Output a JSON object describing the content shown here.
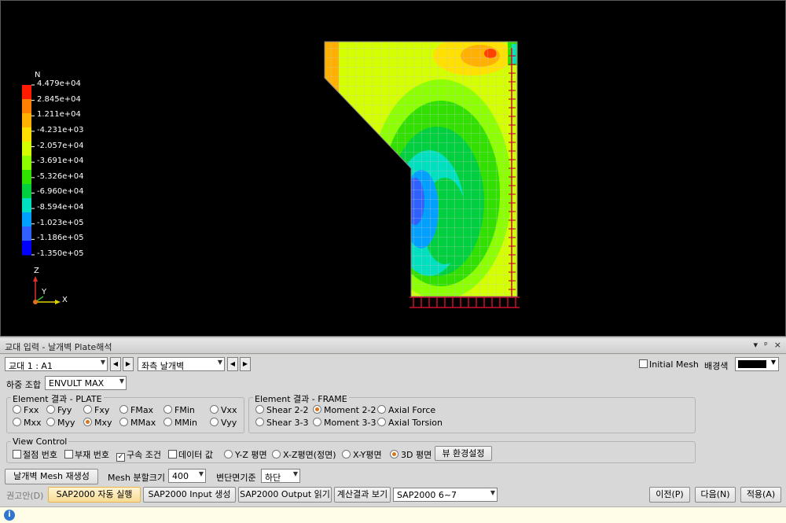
{
  "viewport": {
    "legend_unit": "N",
    "legend_labels": [
      "4.479e+04",
      "2.845e+04",
      "1.211e+04",
      "-4.231e+03",
      "-2.057e+04",
      "-3.691e+04",
      "-5.326e+04",
      "-6.960e+04",
      "-8.594e+04",
      "-1.023e+05",
      "-1.186e+05",
      "-1.350e+05"
    ],
    "legend_colors": [
      "#ff1a00",
      "#ff8000",
      "#ffb000",
      "#ffe000",
      "#d4ff00",
      "#8cff00",
      "#32e000",
      "#00d040",
      "#00e0c0",
      "#00a0ff",
      "#3060ff",
      "#0000ff"
    ],
    "axis": {
      "z": "Z",
      "x": "X",
      "y": "Y"
    }
  },
  "panel": {
    "title": "교대 입력 - 날개벽 Plate해석",
    "title_controls": [
      "▾",
      "ᵖ",
      "×"
    ],
    "abutment_select": "교대 1 : A1",
    "wall_select": "좌측 날개벽",
    "initial_mesh_label": "Initial Mesh",
    "bg_color_label": "배경색",
    "load_combo_label": "하중 조합",
    "load_combo_value": "ENVULT MAX",
    "plate_group": {
      "title": "Element 결과 - PLATE",
      "options": [
        {
          "label": "Fxx",
          "selected": false
        },
        {
          "label": "Fyy",
          "selected": false
        },
        {
          "label": "Fxy",
          "selected": false
        },
        {
          "label": "FMax",
          "selected": false
        },
        {
          "label": "FMin",
          "selected": false
        },
        {
          "label": "Vxx",
          "selected": false
        },
        {
          "label": "Mxx",
          "selected": false
        },
        {
          "label": "Myy",
          "selected": false
        },
        {
          "label": "Mxy",
          "selected": true
        },
        {
          "label": "MMax",
          "selected": false
        },
        {
          "label": "MMin",
          "selected": false
        },
        {
          "label": "Vyy",
          "selected": false
        }
      ]
    },
    "frame_group": {
      "title": "Element 결과 - FRAME",
      "options": [
        {
          "label": "Shear 2-2",
          "selected": false
        },
        {
          "label": "Moment 2-2",
          "selected": true
        },
        {
          "label": "Axial Force",
          "selected": false
        },
        {
          "label": "Shear 3-3",
          "selected": false
        },
        {
          "label": "Moment 3-3",
          "selected": false
        },
        {
          "label": "Axial Torsion",
          "selected": false
        }
      ]
    },
    "view_control": {
      "title": "View Control",
      "checks": [
        {
          "label": "절점 번호",
          "checked": false
        },
        {
          "label": "부재 번호",
          "checked": false
        },
        {
          "label": "구속 조건",
          "checked": true
        },
        {
          "label": "데이터 값",
          "checked": false
        }
      ],
      "planes": [
        {
          "label": "Y-Z 평면",
          "selected": false
        },
        {
          "label": "X-Z평면(정면)",
          "selected": false
        },
        {
          "label": "X-Y평면",
          "selected": false
        },
        {
          "label": "3D 평면",
          "selected": true
        }
      ],
      "env_button": "뷰 환경설정"
    },
    "regen_button": "날개벽 Mesh 재생성",
    "mesh_size_label": "Mesh 분할크기",
    "mesh_size_value": "400",
    "section_label": "변단면기준",
    "section_value": "하단",
    "recommend_label": "권고안(D)",
    "sap_auto_button": "SAP2000 자동 실행",
    "sap_input_button": "SAP2000 Input 생성",
    "sap_output_button": "SAP2000 Output 읽기",
    "calc_result_button": "계산결과 보기",
    "sap_version_value": "SAP2000 6~7",
    "prev_button": "이전(P)",
    "next_button": "다음(N)",
    "apply_button": "적용(A)"
  }
}
